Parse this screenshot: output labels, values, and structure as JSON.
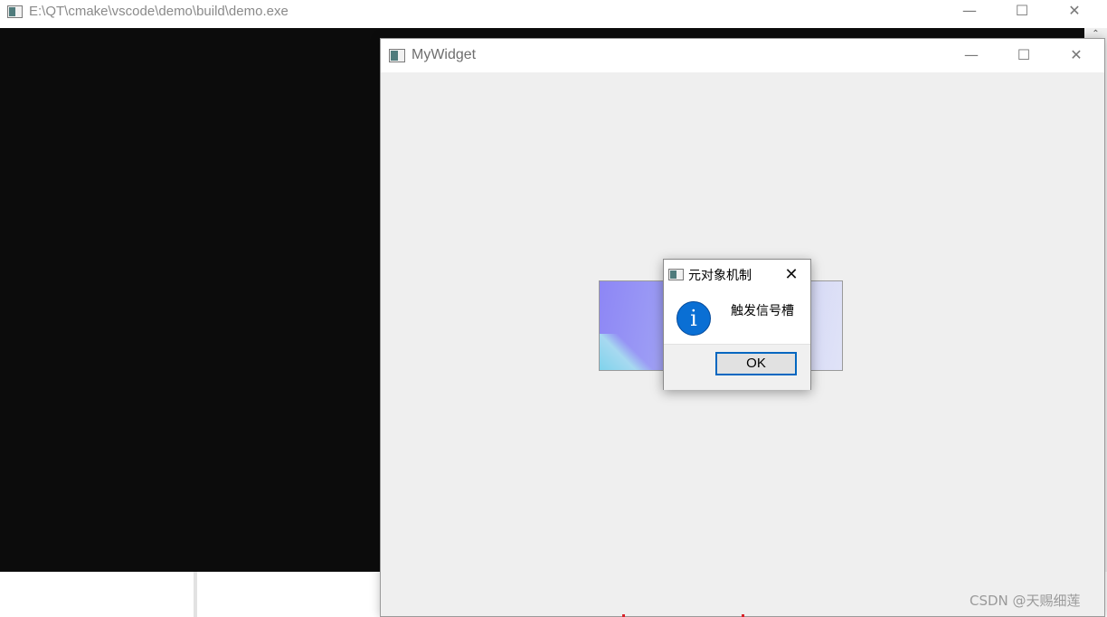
{
  "console_window": {
    "title": "E:\\QT\\cmake\\vscode\\demo\\build\\demo.exe",
    "controls": {
      "minimize": "—",
      "maximize": "☐",
      "close": "✕"
    },
    "scroll_up": "⌃"
  },
  "widget_window": {
    "title": "MyWidget",
    "controls": {
      "minimize": "—",
      "maximize": "☐",
      "close": "✕"
    }
  },
  "message_box": {
    "title": "元对象机制",
    "close": "✕",
    "icon": "information-icon",
    "icon_glyph": "i",
    "message": "触发信号槽",
    "ok_label": "OK"
  },
  "watermark": "CSDN @天赐细莲",
  "colors": {
    "console_bg": "#0c0c0c",
    "window_bg": "#efefef",
    "info_blue": "#0a6fd4",
    "button_focus": "#0067c0"
  }
}
